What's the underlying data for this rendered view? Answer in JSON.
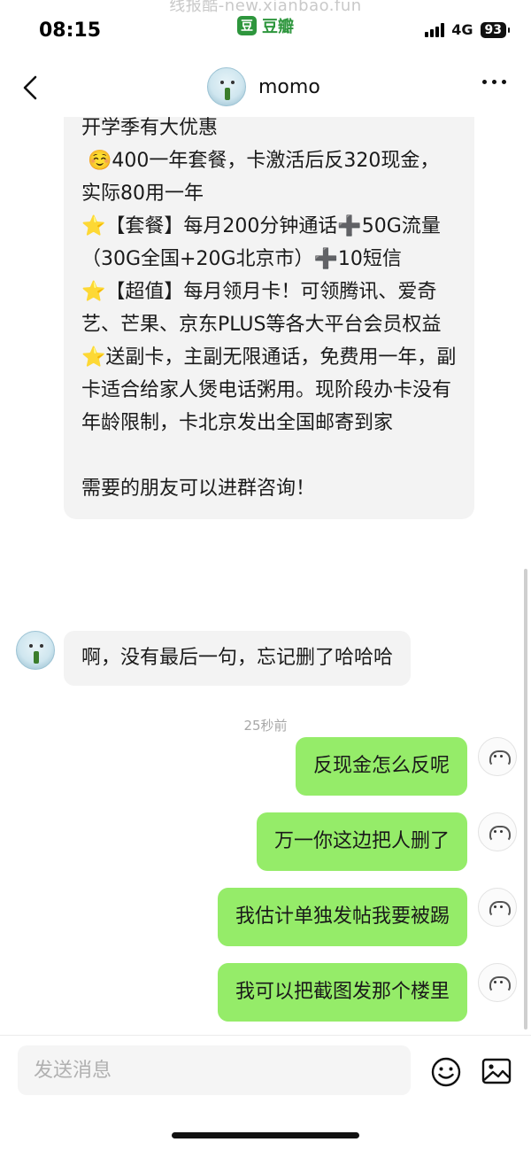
{
  "watermark": "线报酷-new.xianbao.fun",
  "status_bar": {
    "time": "08:15",
    "app_logo": "豆",
    "app_name": "豆瓣",
    "network": "4G",
    "battery": "93"
  },
  "header": {
    "contact_name": "momo",
    "back_icon": "chevron-left-icon",
    "more_icon": "more-dots-icon"
  },
  "messages": {
    "long": {
      "line1": "开学季有大优惠",
      "line2": " ☺️400一年套餐，卡激活后反320现金，实际80用一年",
      "line3": "【套餐】每月200分钟通话➕50G流量（30G全国+20G北京市）➕10短信",
      "line4": "【超值】每月领月卡！可领腾讯、爱奇艺、芒果、京东PLUS等各大平台会员权益",
      "line5": "送副卡，主副无限通话，免费用一年，副卡适合给家人煲电话粥用。现阶段办卡没有年龄限制，卡北京发出全国邮寄到家",
      "line6": "需要的朋友可以进群咨询！",
      "star": "⭐️"
    },
    "short_in": "啊，没有最后一句，忘记删了哈哈哈",
    "timestamp": "25秒前",
    "out": [
      "反现金怎么反呢",
      "万一你这边把人删了",
      "我估计单独发帖我要被踢",
      "我可以把截图发那个楼里"
    ]
  },
  "input": {
    "placeholder": "发送消息"
  },
  "icons": {
    "emoji": "emoji-icon",
    "image": "image-icon"
  }
}
